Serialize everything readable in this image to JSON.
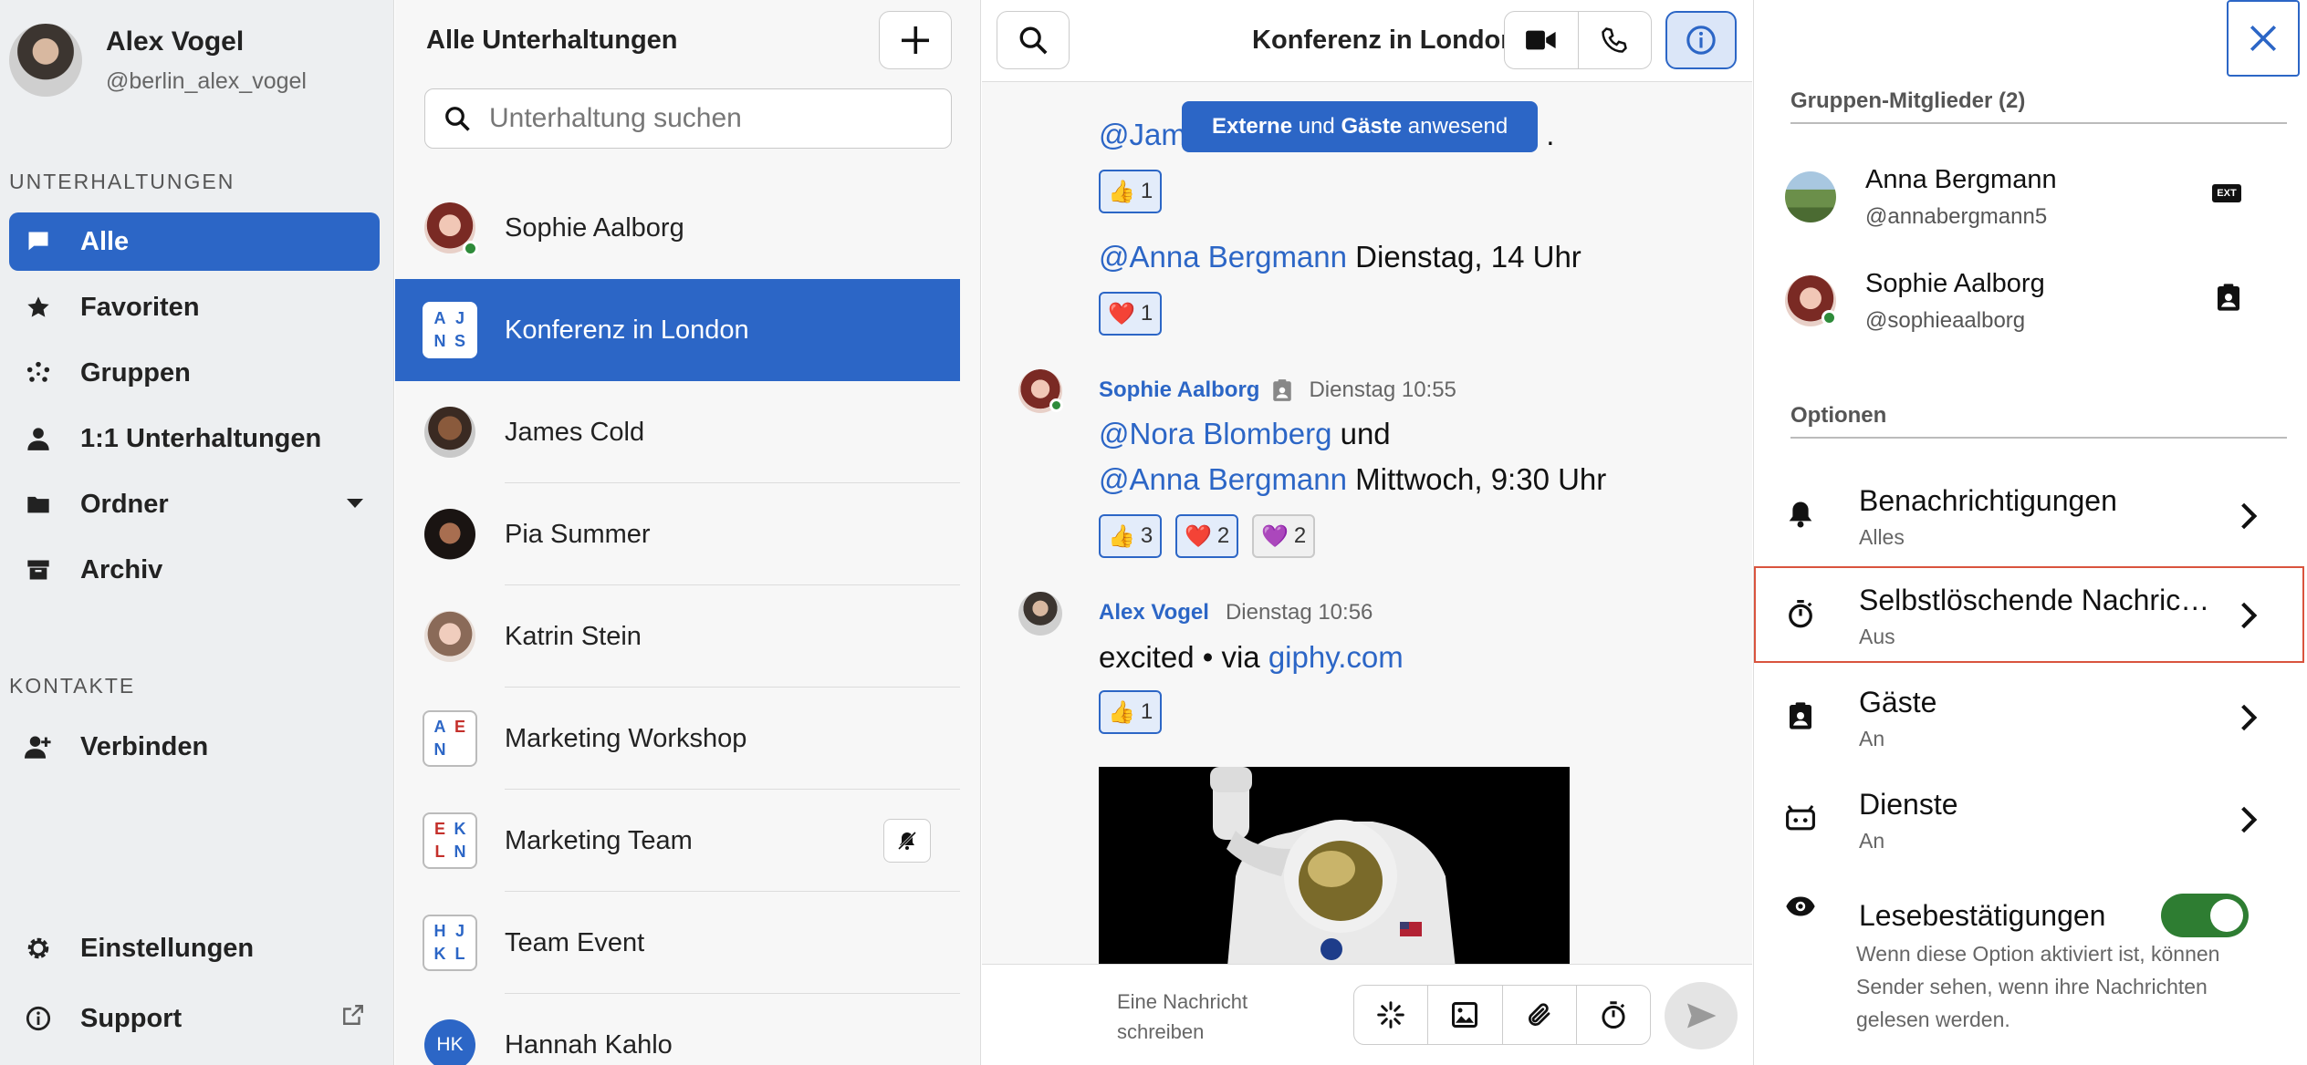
{
  "profile": {
    "name": "Alex Vogel",
    "handle": "@berlin_alex_vogel"
  },
  "sidebar": {
    "section_conversations": "UNTERHALTUNGEN",
    "items": [
      {
        "label": "Alle",
        "icon": "chat-bubble-icon"
      },
      {
        "label": "Favoriten",
        "icon": "star-icon"
      },
      {
        "label": "Gruppen",
        "icon": "group-dots-icon"
      },
      {
        "label": "1:1 Unterhaltungen",
        "icon": "person-icon"
      },
      {
        "label": "Ordner",
        "icon": "folder-icon"
      },
      {
        "label": "Archiv",
        "icon": "archive-icon"
      }
    ],
    "section_contacts": "KONTAKTE",
    "connect_label": "Verbinden",
    "settings_label": "Einstellungen",
    "support_label": "Support"
  },
  "conversation_list": {
    "title": "Alle Unterhaltungen",
    "search_placeholder": "Unterhaltung suchen",
    "items": [
      {
        "name": "Sophie Aalborg"
      },
      {
        "name": "Konferenz in London",
        "initials": [
          "A",
          "J",
          "N",
          "S"
        ]
      },
      {
        "name": "James Cold"
      },
      {
        "name": "Pia Summer"
      },
      {
        "name": "Katrin Stein"
      },
      {
        "name": "Marketing Workshop",
        "initials": [
          "A",
          "E",
          "N"
        ]
      },
      {
        "name": "Marketing Team",
        "initials": [
          "E",
          "K",
          "L",
          "N"
        ]
      },
      {
        "name": "Team Event",
        "initials": [
          "H",
          "J",
          "K",
          "L"
        ]
      },
      {
        "name": "Hannah Kahlo",
        "initials": [
          "HK"
        ]
      }
    ]
  },
  "chat": {
    "title": "Konferenz in London",
    "banner": {
      "part1": "Externe",
      "part2": " und ",
      "part3": "Gäste",
      "part4": " anwesend"
    },
    "messages": {
      "m1_mention": "@Jame",
      "m1_tail": ".",
      "m1_reaction": {
        "emoji": "👍",
        "count": "1"
      },
      "m2_mention": "@Anna Bergmann",
      "m2_text": " Dienstag, 14 Uhr",
      "m2_reaction": {
        "emoji": "❤️",
        "count": "1"
      },
      "m3_sender": "Sophie Aalborg",
      "m3_time": "Dienstag 10:55",
      "m3_line1_mention": "@Nora Blomberg",
      "m3_line1_text": " und",
      "m3_line2_mention": "@Anna Bergmann",
      "m3_line2_text": " Mittwoch, 9:30 Uhr",
      "m3_reactions": [
        {
          "emoji": "👍",
          "count": "3"
        },
        {
          "emoji": "❤️",
          "count": "2"
        },
        {
          "emoji": "💜",
          "count": "2"
        }
      ],
      "m4_sender": "Alex Vogel",
      "m4_time": "Dienstag 10:56",
      "m4_text": "excited • via ",
      "m4_link": "giphy.com",
      "m4_reaction": {
        "emoji": "👍",
        "count": "1"
      }
    },
    "composer_placeholder": "Eine Nachricht schreiben"
  },
  "info_panel": {
    "members_title": "Gruppen-Mitglieder (2)",
    "members": [
      {
        "name": "Anna Bergmann",
        "handle": "@annabergmann5",
        "badge": "EXT"
      },
      {
        "name": "Sophie Aalborg",
        "handle": "@sophieaalborg"
      }
    ],
    "options_title": "Optionen",
    "options": [
      {
        "title": "Benachrichtigungen",
        "value": "Alles",
        "icon": "bell-icon"
      },
      {
        "title": "Selbstlöschende Nachrichten",
        "value": "Aus",
        "icon": "timer-icon"
      },
      {
        "title": "Gäste",
        "value": "An",
        "icon": "guest-badge-icon"
      },
      {
        "title": "Dienste",
        "value": "An",
        "icon": "bot-icon"
      }
    ],
    "read_receipts": {
      "title": "Lesebestätigungen",
      "enabled": true,
      "description": "Wenn diese Option aktiviert ist, können Sender sehen, wenn ihre Nachrichten gelesen werden."
    }
  },
  "colors": {
    "accent": "#2c66c6",
    "highlight": "#d9543e",
    "online": "#2e8b3a",
    "toggle_on": "#2e7d32"
  }
}
